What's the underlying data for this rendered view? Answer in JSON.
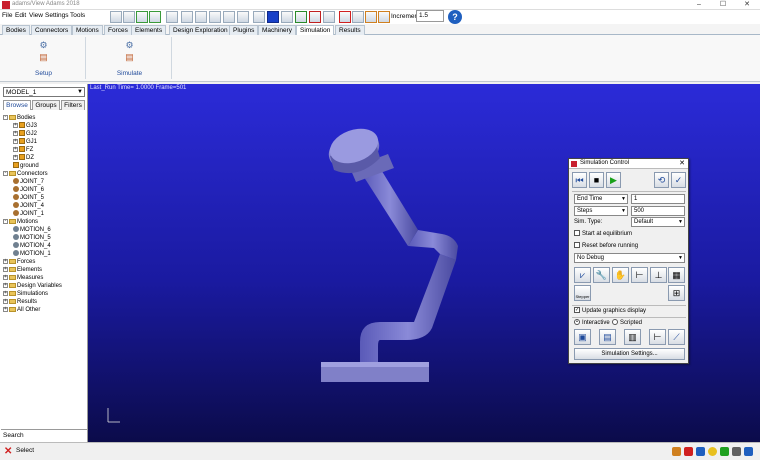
{
  "window": {
    "title": "adams/View Adams 2018"
  },
  "menubar": [
    "File",
    "Edit",
    "View",
    "Settings",
    "Tools"
  ],
  "toolbar": {
    "increment_label": "Increment",
    "increment_value": "1.5",
    "help_label": "?"
  },
  "ribbon_tabs": [
    "Bodies",
    "Connectors",
    "Motions",
    "Forces",
    "Elements",
    "Design Exploration",
    "Plugins",
    "Machinery",
    "Simulation",
    "Results"
  ],
  "active_tab": "Simulation",
  "ribbon_groups": [
    {
      "label": "Setup"
    },
    {
      "label": "Simulate"
    }
  ],
  "left_panel": {
    "model": "MODEL_1",
    "tabs": [
      "Browse",
      "Groups",
      "Filters"
    ],
    "tree": [
      {
        "label": "Bodies",
        "level": 0,
        "kind": "folder",
        "exp": "-"
      },
      {
        "label": "GJ3",
        "level": 1,
        "kind": "part",
        "exp": "+"
      },
      {
        "label": "GJ2",
        "level": 1,
        "kind": "part",
        "exp": "+"
      },
      {
        "label": "GJ1",
        "level": 1,
        "kind": "part",
        "exp": "+"
      },
      {
        "label": "FZ",
        "level": 1,
        "kind": "part",
        "exp": "+"
      },
      {
        "label": "DZ",
        "level": 1,
        "kind": "part",
        "exp": "+"
      },
      {
        "label": "ground",
        "level": 1,
        "kind": "part",
        "exp": ""
      },
      {
        "label": "Connectors",
        "level": 0,
        "kind": "folder",
        "exp": "-"
      },
      {
        "label": "JOINT_7",
        "level": 1,
        "kind": "joint",
        "exp": ""
      },
      {
        "label": "JOINT_6",
        "level": 1,
        "kind": "joint",
        "exp": ""
      },
      {
        "label": "JOINT_5",
        "level": 1,
        "kind": "joint",
        "exp": ""
      },
      {
        "label": "JOINT_4",
        "level": 1,
        "kind": "joint",
        "exp": ""
      },
      {
        "label": "JOINT_1",
        "level": 1,
        "kind": "joint",
        "exp": ""
      },
      {
        "label": "Motions",
        "level": 0,
        "kind": "folder",
        "exp": "-"
      },
      {
        "label": "MOTION_6",
        "level": 1,
        "kind": "motion",
        "exp": ""
      },
      {
        "label": "MOTION_5",
        "level": 1,
        "kind": "motion",
        "exp": ""
      },
      {
        "label": "MOTION_4",
        "level": 1,
        "kind": "motion",
        "exp": ""
      },
      {
        "label": "MOTION_1",
        "level": 1,
        "kind": "motion",
        "exp": ""
      },
      {
        "label": "Forces",
        "level": 0,
        "kind": "folder",
        "exp": "+"
      },
      {
        "label": "Elements",
        "level": 0,
        "kind": "folder",
        "exp": "+"
      },
      {
        "label": "Measures",
        "level": 0,
        "kind": "folder",
        "exp": "+"
      },
      {
        "label": "Design Variables",
        "level": 0,
        "kind": "folder",
        "exp": "+"
      },
      {
        "label": "Simulations",
        "level": 0,
        "kind": "folder",
        "exp": "+"
      },
      {
        "label": "Results",
        "level": 0,
        "kind": "folder",
        "exp": "+"
      },
      {
        "label": "All Other",
        "level": 0,
        "kind": "folder",
        "exp": "+"
      }
    ],
    "search_label": "Search"
  },
  "viewport": {
    "run_info": "Last_Run   Time=  1.0000  Frame=501"
  },
  "sim_control": {
    "title": "Simulation Control",
    "end_time_label": "End Time",
    "end_time_value": "1",
    "steps_label": "Steps",
    "steps_value": "500",
    "sim_type_label": "Sim. Type:",
    "sim_type_value": "Default",
    "start_equilibrium": "Start at equilibrium",
    "reset_before": "Reset before running",
    "debug_value": "No Debug",
    "update_graphics": "Update graphics display",
    "interactive": "Interactive",
    "scripted": "Scripted",
    "settings_button": "Simulation Settings...",
    "stepper_label": "Stepper"
  },
  "statusbar": {
    "text": "Select"
  }
}
